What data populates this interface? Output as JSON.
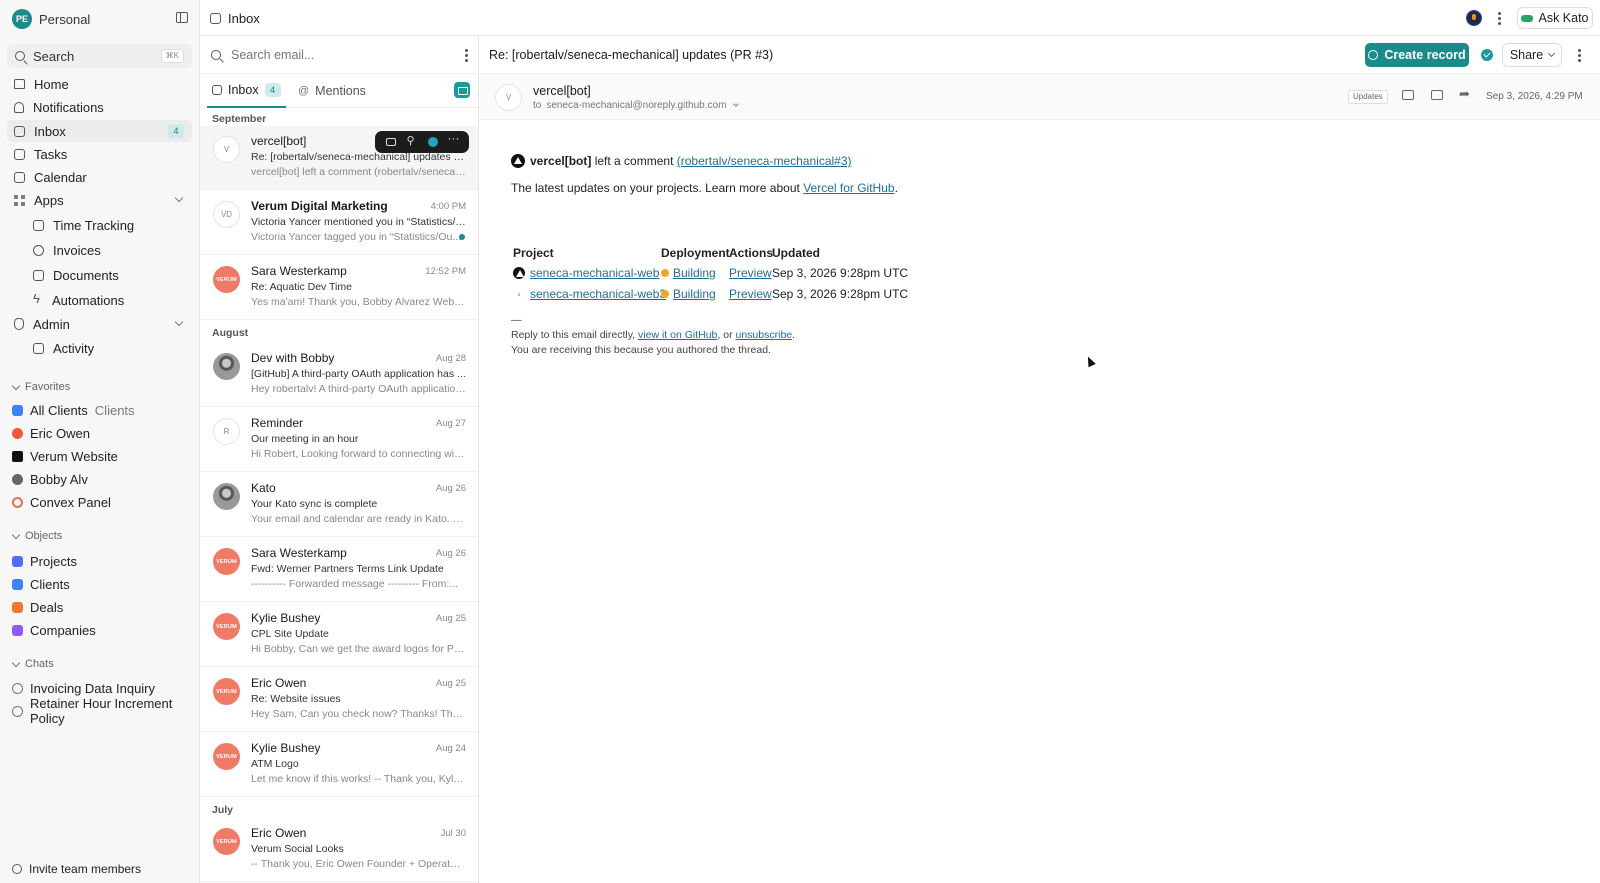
{
  "sidebar": {
    "workspace_badge": "PE",
    "workspace_name": "Personal",
    "search_label": "Search",
    "search_shortcut": "⌘K",
    "nav": [
      {
        "label": "Home",
        "icon": "home-icon"
      },
      {
        "label": "Notifications",
        "icon": "bell-icon"
      },
      {
        "label": "Inbox",
        "icon": "inbox-icon",
        "count": "4"
      },
      {
        "label": "Tasks",
        "icon": "check-square-icon"
      },
      {
        "label": "Calendar",
        "icon": "calendar-icon"
      },
      {
        "label": "Apps",
        "icon": "grid-icon"
      }
    ],
    "apps": [
      {
        "label": "Time Tracking",
        "icon": "clock-icon"
      },
      {
        "label": "Invoices",
        "icon": "dollar-icon"
      },
      {
        "label": "Documents",
        "icon": "document-icon"
      },
      {
        "label": "Automations",
        "icon": "bolt-icon"
      }
    ],
    "admin_label": "Admin",
    "admin_items": [
      {
        "label": "Activity",
        "icon": "activity-icon"
      }
    ],
    "favorites_label": "Favorites",
    "favorites": [
      {
        "label": "All Clients",
        "secondary": "Clients",
        "color": "#3b82f6"
      },
      {
        "label": "Eric Owen",
        "color": "#ef5a3c"
      },
      {
        "label": "Verum Website",
        "color": "#111111"
      },
      {
        "label": "Bobby Alv",
        "color": "#666666"
      },
      {
        "label": "Convex Panel",
        "color": "#f06a4e"
      }
    ],
    "objects_label": "Objects",
    "objects": [
      {
        "label": "Projects",
        "color": "#4f6ef7"
      },
      {
        "label": "Clients",
        "color": "#3b82f6"
      },
      {
        "label": "Deals",
        "color": "#f07a2a"
      },
      {
        "label": "Companies",
        "color": "#8b5cf6"
      }
    ],
    "chats_label": "Chats",
    "chats": [
      {
        "label": "Invoicing Data Inquiry"
      },
      {
        "label": "Retainer Hour Increment Policy"
      }
    ],
    "invite_label": "Invite team members"
  },
  "topbar": {
    "title": "Inbox",
    "ask_label": "Ask Kato"
  },
  "list": {
    "search_placeholder": "Search email...",
    "tabs": [
      {
        "label": "Inbox",
        "count": "4"
      },
      {
        "label": "Mentions"
      }
    ],
    "groups": [
      "September",
      "August",
      "July"
    ],
    "mails": [
      {
        "from": "vercel[bot]",
        "time": "",
        "subject": "Re: [robertalv/seneca-mechanical] updates (PR #3)",
        "preview": "vercel[bot] left a comment (robertalv/seneca-mechanical#3)",
        "avatar": "V"
      },
      {
        "from": "Verum Digital Marketing",
        "time": "4:00 PM",
        "subject": "Victoria Yancer mentioned you in “Statistics/Ou...",
        "preview": "Victoria Yancer tagged you in “Statistics/Ou...",
        "avatar": "VD"
      },
      {
        "from": "Sara Westerkamp",
        "time": "12:52 PM",
        "subject": "Re: Aquatic Dev Time",
        "preview": "Yes ma'am! Thank you, Bobby Alvarez Web De...",
        "avatar": "VERUM"
      },
      {
        "from": "Dev with Bobby",
        "time": "Aug 28",
        "subject": "[GitHub] A third-party OAuth application has ...",
        "preview": "Hey robertalv! A third-party OAuth application ...",
        "avatar": ""
      },
      {
        "from": "Reminder",
        "time": "Aug 27",
        "subject": "Our meeting in an hour",
        "preview": "Hi Robert, Looking forward to connecting with ...",
        "avatar": "R"
      },
      {
        "from": "Kato",
        "time": "Aug 26",
        "subject": "Your Kato sync is complete",
        "preview": "Your email and calendar are ready in Kato. Kato...",
        "avatar": ""
      },
      {
        "from": "Sara Westerkamp",
        "time": "Aug 26",
        "subject": "Fwd: Werner Partners Terms Link Update",
        "preview": "---------- Forwarded message --------- From:...",
        "avatar": "VERUM"
      },
      {
        "from": "Kylie Bushey",
        "time": "Aug 25",
        "subject": "CPL Site Update",
        "preview": "Hi Bobby, Can we get the award logos for Pebb...",
        "avatar": "VERUM"
      },
      {
        "from": "Eric Owen",
        "time": "Aug 25",
        "subject": "Re: Website issues",
        "preview": "Hey Sam, Can you check now? Thanks! Thank ...",
        "avatar": "VERUM"
      },
      {
        "from": "Kylie Bushey",
        "time": "Aug 24",
        "subject": "ATM Logo",
        "preview": "Let me know if this works! -- Thank you, Kylie ...",
        "avatar": "VERUM"
      },
      {
        "from": "Eric Owen",
        "time": "Jul 30",
        "subject": "Verum Social Looks",
        "preview": "-- Thank you, Eric Owen Founder + Operator 4...",
        "avatar": "VERUM"
      }
    ]
  },
  "pane": {
    "subject": "Re: [robertalv/seneca-mechanical] updates (PR #3)",
    "create_label": "Create record",
    "share_label": "Share",
    "sender": "vercel[bot]",
    "avatar": "V",
    "to_prefix": "to",
    "to_address": "seneca-mechanical@noreply.github.com",
    "tag": "Updates",
    "date": "Sep 3, 2026, 4:29 PM",
    "body": {
      "comment_author": "vercel[bot]",
      "comment_text": "left a comment",
      "comment_link": "(robertalv/seneca-mechanical#3)",
      "intro": "The latest updates on your projects. Learn more about",
      "intro_link": "Vercel for GitHub",
      "intro_end": ".",
      "headers": [
        "Project",
        "Deployment",
        "Actions",
        "Updated"
      ],
      "rows": [
        {
          "project": "seneca-mechanical-web",
          "status": "Building",
          "action": "Preview",
          "updated": "Sep 3, 2026 9:28pm UTC"
        },
        {
          "project": "seneca-mechanical-web3",
          "status": "Building",
          "action": "Preview",
          "updated": "Sep 3, 2026 9:28pm UTC"
        }
      ],
      "dash": "—",
      "footer_a": "Reply to this email directly,",
      "footer_link1": "view it on GitHub",
      "footer_b": ", or",
      "footer_link2": "unsubscribe",
      "footer_c": ".",
      "footer_line2": "You are receiving this because you authored the thread."
    }
  }
}
